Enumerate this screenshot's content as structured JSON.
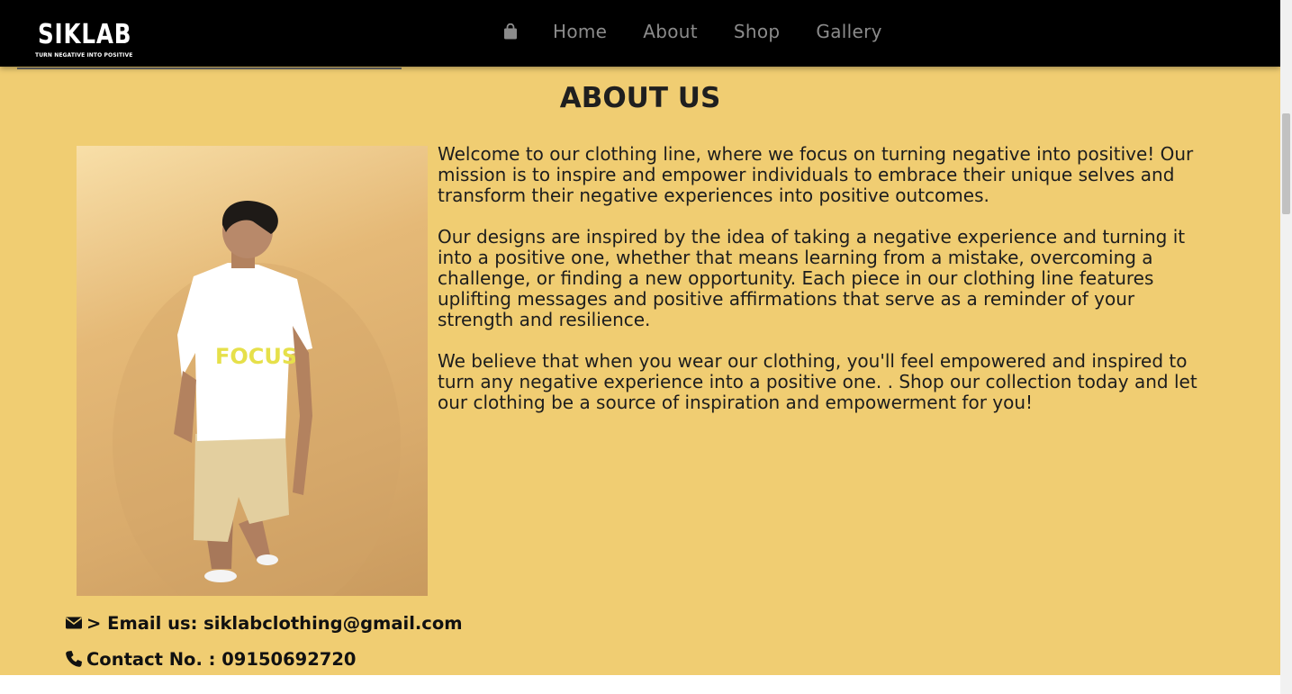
{
  "header": {
    "logo": {
      "brand": "SIKLAB",
      "tagline": "TURN NEGATIVE INTO POSITIVE"
    },
    "cart_icon": "shopping-bag-icon",
    "nav": [
      {
        "label": "Home"
      },
      {
        "label": "About"
      },
      {
        "label": "Shop"
      },
      {
        "label": "Gallery"
      }
    ]
  },
  "main": {
    "title": "ABOUT US",
    "photo": {
      "shirt_text": "FOCUS"
    },
    "paragraphs": [
      "Welcome to our clothing line, where we focus on turning negative into positive! Our mission is to inspire and empower individuals to embrace their unique selves and transform their negative experiences into positive outcomes.",
      "Our designs are inspired by the idea of taking a negative experience and turning it into a positive one, whether that means learning from a mistake, overcoming a challenge, or finding a new opportunity. Each piece in our clothing line features uplifting messages and positive affirmations that serve as a reminder of your strength and resilience.",
      "We believe that when you wear our clothing, you'll feel empowered and inspired to turn any negative experience into a positive one. . Shop our collection today and let our clothing be a source of inspiration and empowerment for you!"
    ]
  },
  "contact": {
    "email": {
      "icon": "envelope-icon",
      "text": "> Email us: siklabclothing@gmail.com"
    },
    "phone": {
      "icon": "phone-icon",
      "text": "Contact No. : 09150692720"
    }
  },
  "colors": {
    "background": "#f0cd72",
    "navbar": "#000000",
    "nav_text": "#8b8b8b",
    "text": "#1d1d1d"
  }
}
